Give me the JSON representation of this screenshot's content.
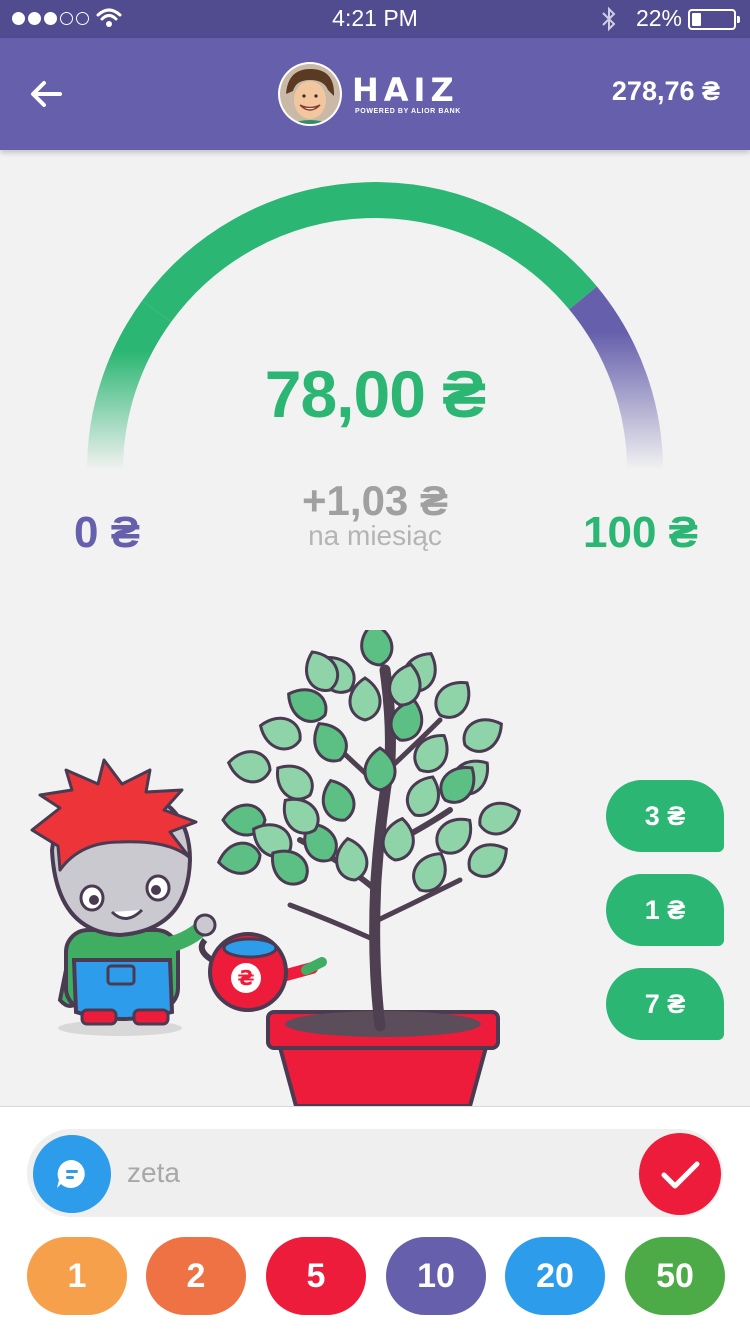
{
  "status_bar": {
    "signal_filled": 3,
    "signal_total": 5,
    "time": "4:21 PM",
    "battery_label": "22%",
    "battery_level": 0.22,
    "icons": [
      "wifi-icon",
      "bluetooth-icon",
      "battery-icon"
    ]
  },
  "header": {
    "back_icon": "arrow-left-icon",
    "logo_text": "HAIZ",
    "logo_subtitle": "POWERED BY ALIOR BANK",
    "balance": "278,76 ₴"
  },
  "gauge": {
    "amount": "78,00 ₴",
    "monthly_change": "+1,03 ₴",
    "per_month_label": "na miesiąc",
    "min_label": "0 ₴",
    "max_label": "100 ₴",
    "min_value": 0,
    "max_value": 100,
    "current_value": 78,
    "colors": {
      "progress": "#2bb673",
      "remaining": "#6660ac"
    }
  },
  "quick_amounts": [
    "3 ₴",
    "1 ₴",
    "7 ₴"
  ],
  "composer": {
    "input_value": "",
    "placeholder": "zeta",
    "message_icon": "chat-bubble-icon",
    "confirm_icon": "checkmark-icon"
  },
  "amount_buttons": [
    {
      "label": "1",
      "color": "#f7a04b"
    },
    {
      "label": "2",
      "color": "#ef7244"
    },
    {
      "label": "5",
      "color": "#ed1c3a"
    },
    {
      "label": "10",
      "color": "#6660ac"
    },
    {
      "label": "20",
      "color": "#2d9cea"
    },
    {
      "label": "50",
      "color": "#4cab46"
    }
  ]
}
